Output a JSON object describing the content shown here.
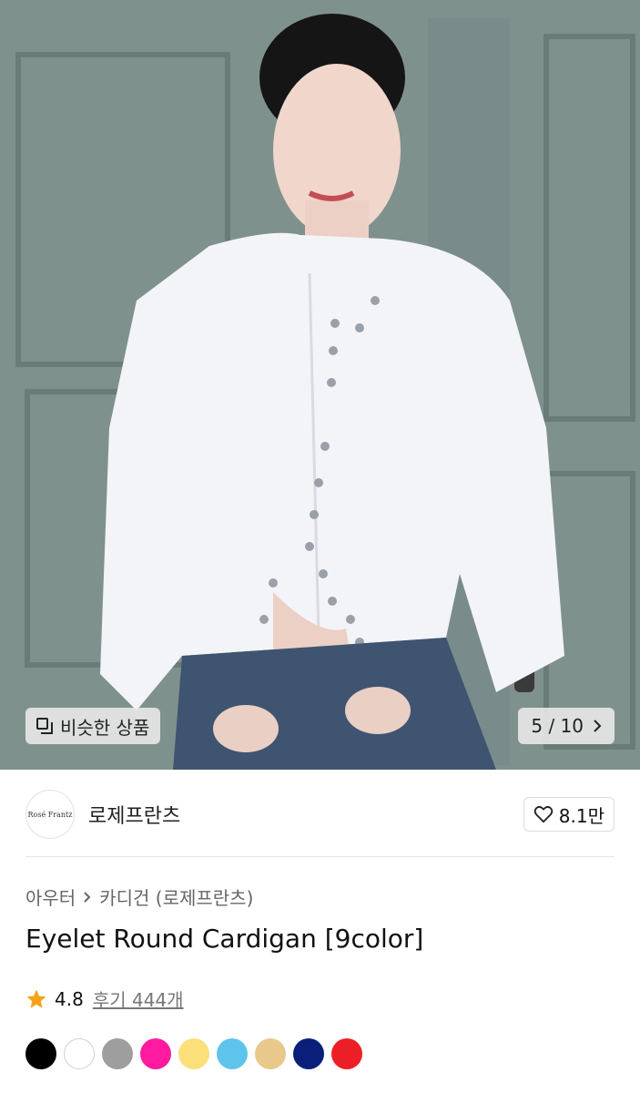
{
  "gallery": {
    "similar_label": "비슷한 상품",
    "counter": "5 / 10"
  },
  "brand": {
    "logo_text": "Rosé Frantz",
    "name": "로제프란츠",
    "like_count": "8.1만"
  },
  "breadcrumb": {
    "level1": "아우터",
    "level2": "카디건 (로제프란츠)"
  },
  "product": {
    "title": "Eyelet Round Cardigan [9color]",
    "rating": "4.8",
    "reviews": "후기 444개"
  },
  "colors": [
    "#000000",
    "#ffffff",
    "#9e9e9e",
    "#ff1aa0",
    "#fbe07a",
    "#5ec4ec",
    "#e9c88c",
    "#0a1f7a",
    "#ec1f27"
  ],
  "icons": {
    "similar": "overlapping-squares-icon",
    "next": "chevron-right-icon",
    "like": "heart-outline-icon",
    "star": "star-filled-icon",
    "separator": "chevron-right-icon"
  }
}
